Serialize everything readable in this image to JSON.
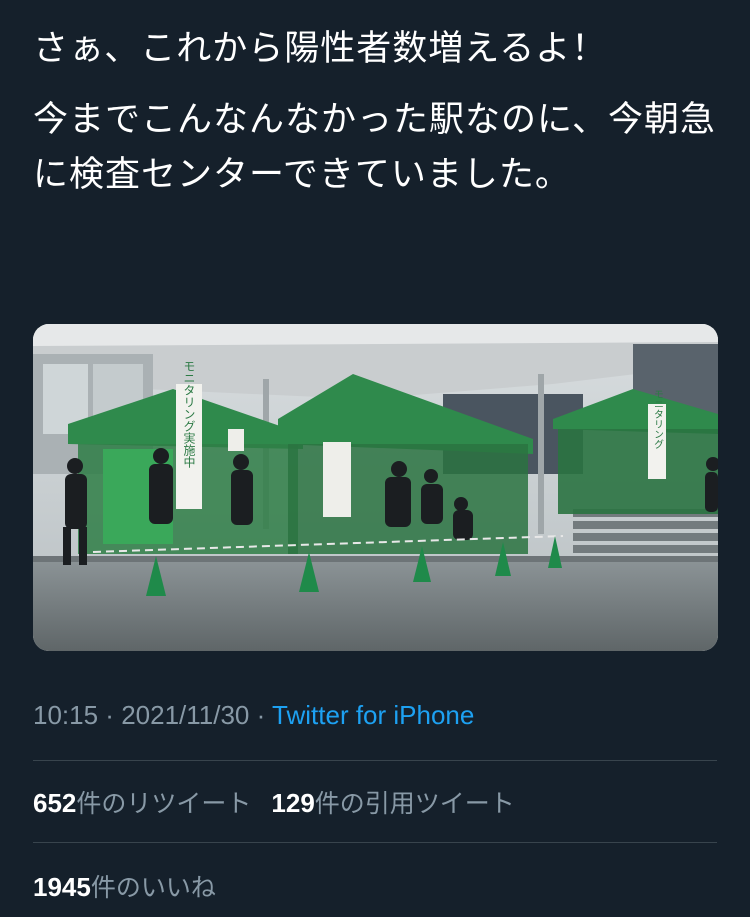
{
  "tweet": {
    "line1": "さぁ、これから陽性者数増えるよ！",
    "line2": "今までこんなんなかった駅なのに、今朝急に検査センターできていました。"
  },
  "photo": {
    "tent_sign_left": "モニタリング実施中",
    "tent_sign_right": "モニタリング"
  },
  "meta": {
    "time": "10:15",
    "separator": " · ",
    "date": "2021/11/30",
    "source": "Twitter for iPhone"
  },
  "stats": {
    "retweets_count": "652",
    "retweets_label": "件のリツイート",
    "quotes_count": "129",
    "quotes_label": "件の引用ツイート",
    "likes_count": "1945",
    "likes_label": "件のいいね"
  },
  "colors": {
    "background": "#15202b",
    "text": "#ffffff",
    "secondary": "#8899a6",
    "link": "#1da1f2",
    "divider": "#38444d"
  }
}
